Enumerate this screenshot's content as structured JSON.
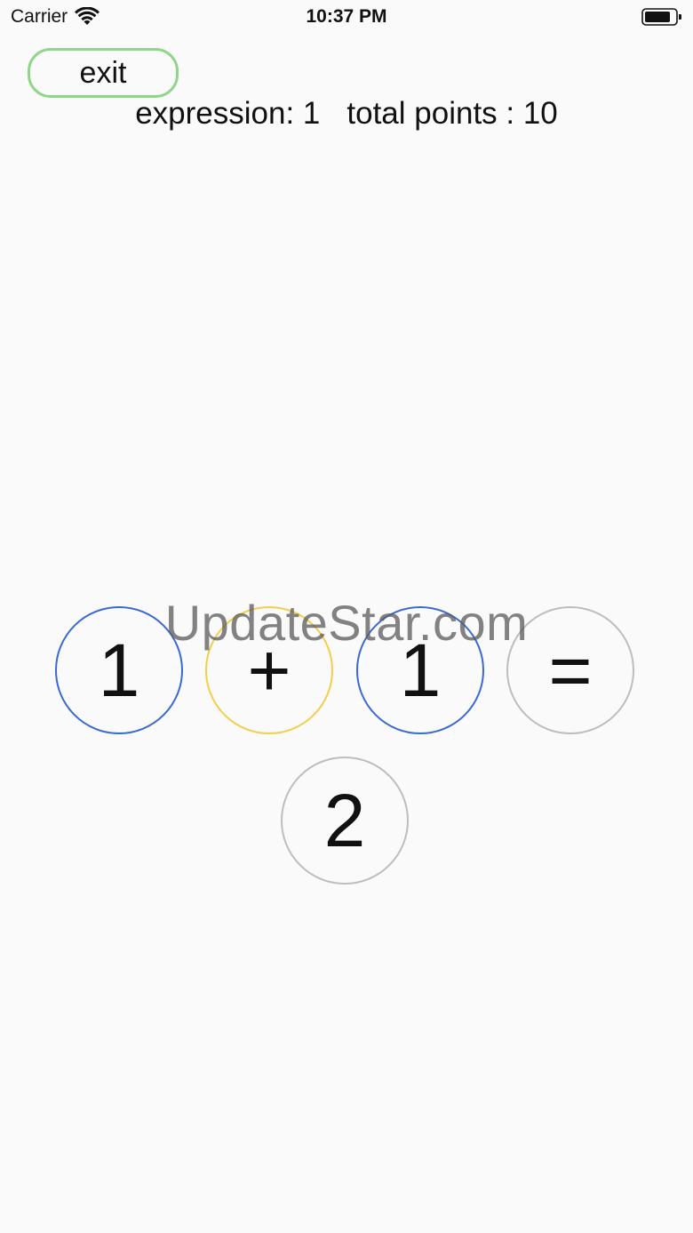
{
  "status_bar": {
    "carrier": "Carrier",
    "time": "10:37 PM",
    "icons": [
      "wifi-icon",
      "battery-icon"
    ]
  },
  "exit_label": "exit",
  "score": {
    "expression_text": "expression: 1",
    "total_points_text": "total points : 10"
  },
  "tiles": [
    "1",
    "+",
    "1",
    "="
  ],
  "tile_colors": [
    "#3a69d6",
    "#f5cd4a",
    "#3a69d6",
    "#bdbdbd"
  ],
  "answer": "2",
  "watermark": "UpdateStar.com",
  "colors": {
    "background": "#fafafa",
    "exit_border": "#8fd58a",
    "number_tile": "#3a69d6",
    "operator_tile": "#f5cd4a",
    "neutral_tile": "#bdbdbd"
  }
}
